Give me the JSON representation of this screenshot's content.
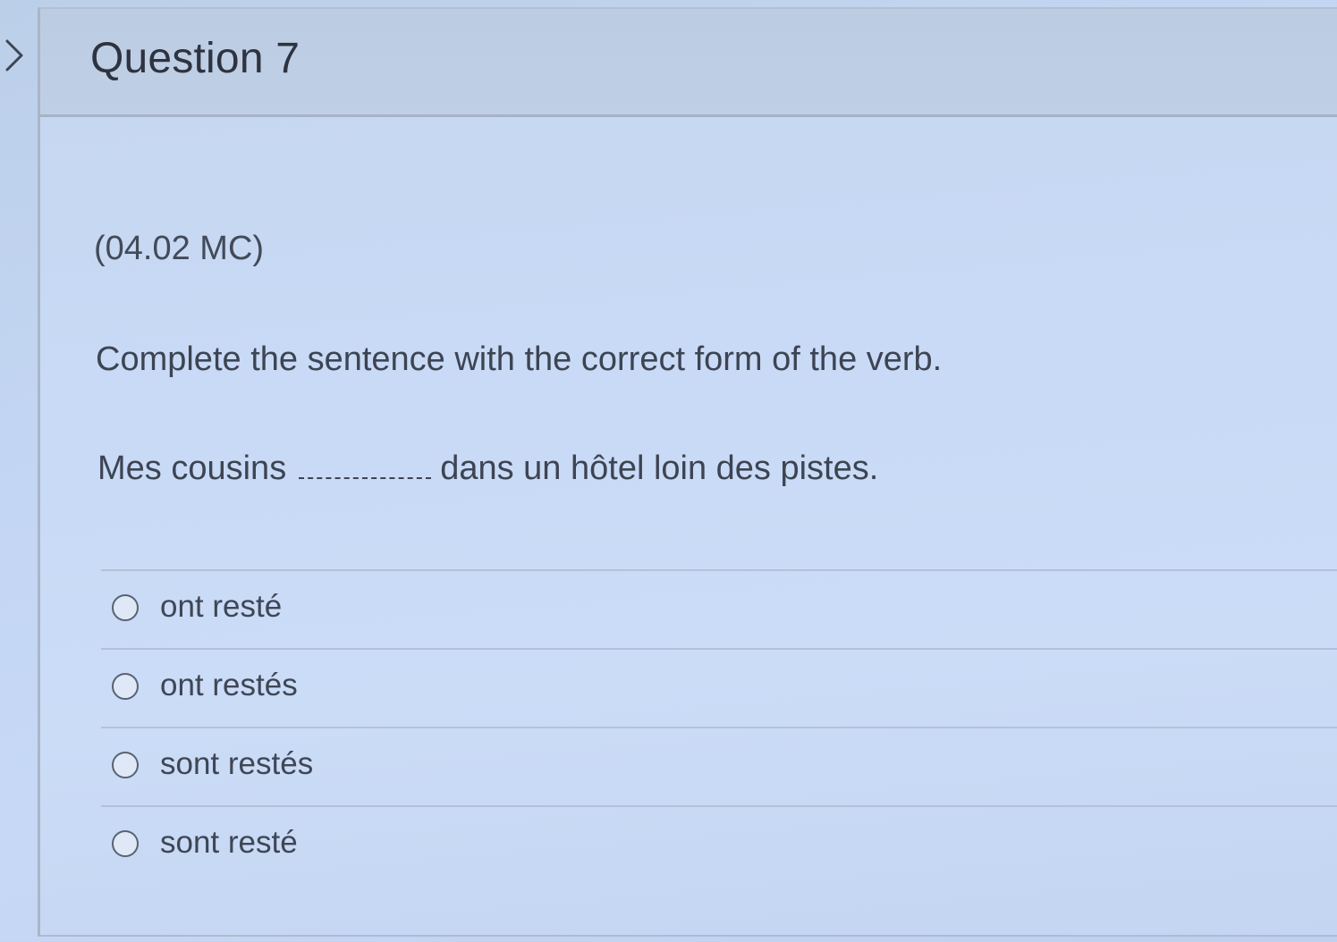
{
  "question": {
    "title": "Question 7",
    "code": "(04.02 MC)",
    "instruction": "Complete the sentence with the correct form of the verb.",
    "sentence_before": "Mes cousins",
    "sentence_after": "dans un hôtel loin des pistes."
  },
  "options": [
    {
      "label": "ont resté",
      "selected": false
    },
    {
      "label": "ont restés",
      "selected": false
    },
    {
      "label": "sont restés",
      "selected": false
    },
    {
      "label": "sont resté",
      "selected": false
    }
  ],
  "icons": {
    "nav": "chevron-right-icon"
  },
  "colors": {
    "background": "#c6d8f5",
    "header": "#bfcfe6",
    "text": "#3b4150",
    "divider": "#b2c2d8"
  }
}
